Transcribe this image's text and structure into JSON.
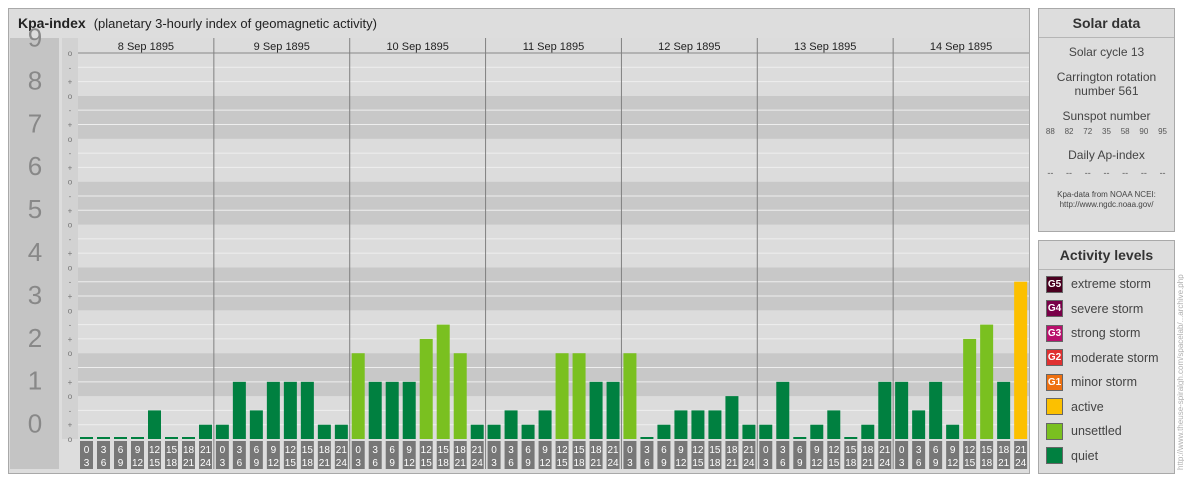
{
  "header": {
    "title": "Kpa-index",
    "subtitle": "(planetary 3-hourly index of geomagnetic activity)"
  },
  "chart_data": {
    "type": "bar",
    "title": "Kpa-index",
    "subtitle": "(planetary 3-hourly index of geomagnetic activity)",
    "y_levels": [
      "0",
      "1",
      "2",
      "3",
      "4",
      "5",
      "6",
      "7",
      "8",
      "9"
    ],
    "minor_ticks": [
      "o",
      "+",
      "-"
    ],
    "ylim": [
      0,
      9
    ],
    "days": [
      {
        "label": "8 Sep 1895",
        "values": [
          0,
          0,
          0,
          0,
          0.667,
          0,
          0,
          0.333
        ]
      },
      {
        "label": "9 Sep 1895",
        "values": [
          0.333,
          1.333,
          0.667,
          1.333,
          1.333,
          1.333,
          0.333,
          0.333
        ]
      },
      {
        "label": "10 Sep 1895",
        "values": [
          2,
          1.333,
          1.333,
          1.333,
          2.333,
          2.667,
          2,
          0.333
        ]
      },
      {
        "label": "11 Sep 1895",
        "values": [
          0.333,
          0.667,
          0.333,
          0.667,
          2,
          2,
          1.333,
          1.333
        ]
      },
      {
        "label": "12 Sep 1895",
        "values": [
          2,
          0,
          0.333,
          0.667,
          0.667,
          0.667,
          1,
          0.333
        ]
      },
      {
        "label": "13 Sep 1895",
        "values": [
          0.333,
          1.333,
          0,
          0.333,
          0.667,
          0,
          0.333,
          1.333
        ]
      },
      {
        "label": "14 Sep 1895",
        "values": [
          1.333,
          0.667,
          1.333,
          0.333,
          2.333,
          2.667,
          1.333,
          3.667
        ]
      }
    ],
    "hour_bins": [
      [
        "0",
        "3"
      ],
      [
        "3",
        "6"
      ],
      [
        "6",
        "9"
      ],
      [
        "9",
        "12"
      ],
      [
        "12",
        "15"
      ],
      [
        "15",
        "18"
      ],
      [
        "18",
        "21"
      ],
      [
        "21",
        "24"
      ]
    ],
    "colors": {
      "quiet": "#008040",
      "unsettled": "#7ac020",
      "active": "#fcc000"
    }
  },
  "solar_data": {
    "title": "Solar data",
    "solar_cycle": "Solar cycle 13",
    "carrington_line1": "Carrington rotation",
    "carrington_line2": "number 561",
    "sunspot_title": "Sunspot number",
    "sunspot_numbers": [
      "88",
      "82",
      "72",
      "35",
      "58",
      "90",
      "95"
    ],
    "ap_title": "Daily Ap-index",
    "ap_values": [
      "--",
      "--",
      "--",
      "--",
      "--",
      "--",
      "--"
    ],
    "source_line1": "Kpa-data from NOAA NCEI:",
    "source_line2": "http://www.ngdc.noaa.gov/"
  },
  "activity_levels": {
    "title": "Activity levels",
    "items": [
      {
        "code": "G5",
        "label": "extreme storm",
        "color": "#4a0020"
      },
      {
        "code": "G4",
        "label": "severe storm",
        "color": "#780048"
      },
      {
        "code": "G3",
        "label": "strong storm",
        "color": "#b8106c"
      },
      {
        "code": "G2",
        "label": "moderate storm",
        "color": "#e03030"
      },
      {
        "code": "G1",
        "label": "minor storm",
        "color": "#ee7010"
      },
      {
        "code": "",
        "label": "active",
        "color": "#fcc000"
      },
      {
        "code": "",
        "label": "unsettled",
        "color": "#7ac020"
      },
      {
        "code": "",
        "label": "quiet",
        "color": "#008040"
      }
    ]
  },
  "watermark": "http://www.theuse-spiralgh.com/spacelab/...archive.php"
}
